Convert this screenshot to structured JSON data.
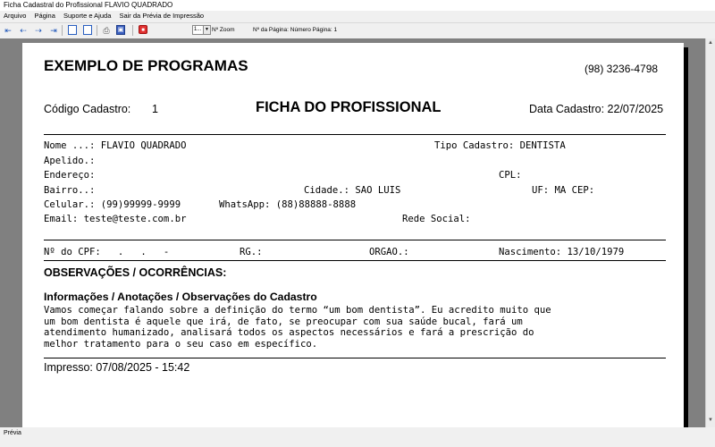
{
  "window": {
    "title": "Ficha Cadastral do Profissional FLAVIO QUADRADO"
  },
  "menu": {
    "items": [
      "Arquivo",
      "Página",
      "Suporte e Ajuda",
      "Sair da Prévia de Impressão"
    ]
  },
  "toolbar": {
    "zoom_value": "1...",
    "zoom_label": "Nº Zoom",
    "page_label": "Nº da Página: Número Página: 1"
  },
  "report": {
    "company": "EXEMPLO DE PROGRAMAS",
    "phone": "(98) 3236-4798",
    "codigo_label": "Código Cadastro:",
    "codigo_value": "1",
    "title": "FICHA DO PROFISSIONAL",
    "data_cadastro": "Data Cadastro: 22/07/2025",
    "nome": "Nome ...: FLAVIO QUADRADO",
    "tipo": "Tipo Cadastro: DENTISTA",
    "apelido": "Apelido.:",
    "endereco": "Endereço:",
    "cpl": "CPL:",
    "bairro": "Bairro..:",
    "cidade": "Cidade.: SAO LUIS",
    "uf": "UF: MA CEP:",
    "celular": "Celular.: (99)99999-9999",
    "whatsapp": "WhatsApp: (88)88888-8888",
    "email": "Email: teste@teste.com.br",
    "rede": "Rede Social:",
    "cpf": "Nº do CPF:   .   .   -",
    "rg": "RG.:",
    "orgao": "ORGAO.:",
    "nascimento": "Nascimento: 13/10/1979",
    "obs_heading": "OBSERVAÇÕES / OCORRÊNCIAS:",
    "info_heading": "Informações / Anotações / Observações do Cadastro",
    "obs_lines": [
      "Vamos começar falando sobre a definição do termo “um bom dentista”. Eu acredito muito que",
      "um bom dentista é aquele que irá, de fato, se preocupar com sua saúde bucal, fará um",
      "atendimento humanizado, analisará todos os aspectos necessários e fará a prescrição do",
      "melhor tratamento para o seu caso em específico."
    ],
    "impresso": "Impresso: 07/08/2025 - 15:42"
  },
  "status": {
    "text": "Prévia"
  },
  "icons": [
    "first-page-icon",
    "prev-page-icon",
    "next-page-icon",
    "last-page-icon",
    "page-icon",
    "two-pages-icon",
    "printer-icon",
    "zoom-icon",
    "close-preview-icon"
  ]
}
